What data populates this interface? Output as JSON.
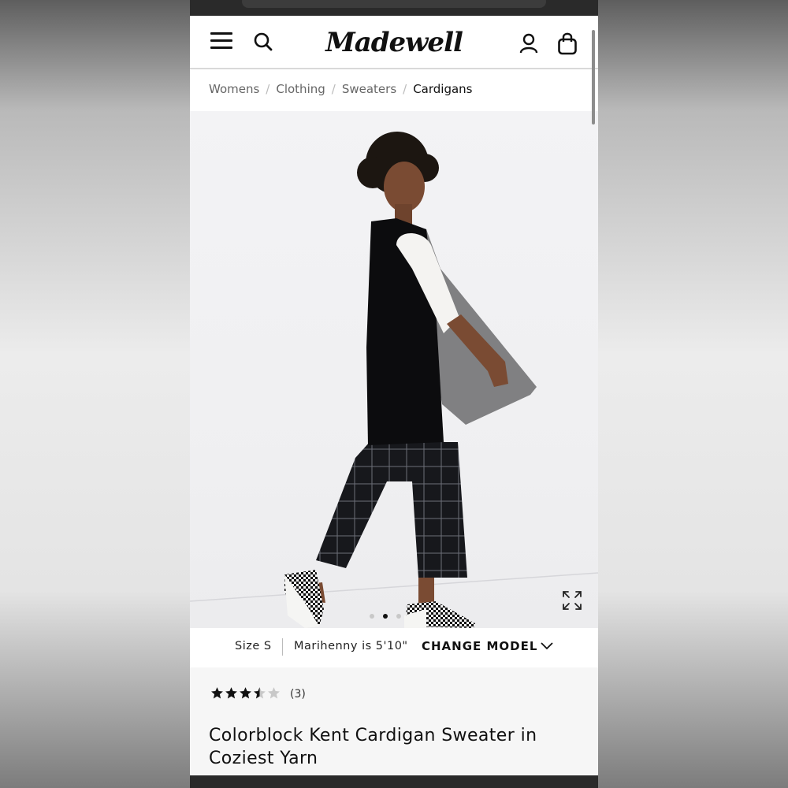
{
  "brand": {
    "logo_text": "Madewell"
  },
  "breadcrumb": {
    "items": [
      "Womens",
      "Clothing",
      "Sweaters"
    ],
    "current": "Cardigans",
    "separator": "/"
  },
  "header_icons": [
    "menu-icon",
    "search-icon",
    "account-icon",
    "bag-icon"
  ],
  "gallery": {
    "image_count": 3,
    "active_index": 2
  },
  "model_info": {
    "size": "Size S",
    "height": "Marihenny is 5'10\"",
    "change_label": "CHANGE MODEL"
  },
  "product": {
    "rating": 3.5,
    "rating_max": 5,
    "review_count": "(3)",
    "title": "Colorblock Kent Cardigan Sweater in Coziest Yarn"
  },
  "colors": {
    "text_primary": "#111111",
    "breadcrumb_text": "#666666",
    "star_filled": "#111111",
    "star_empty": "#c8c8c8",
    "details_bg": "#f6f6f6"
  }
}
